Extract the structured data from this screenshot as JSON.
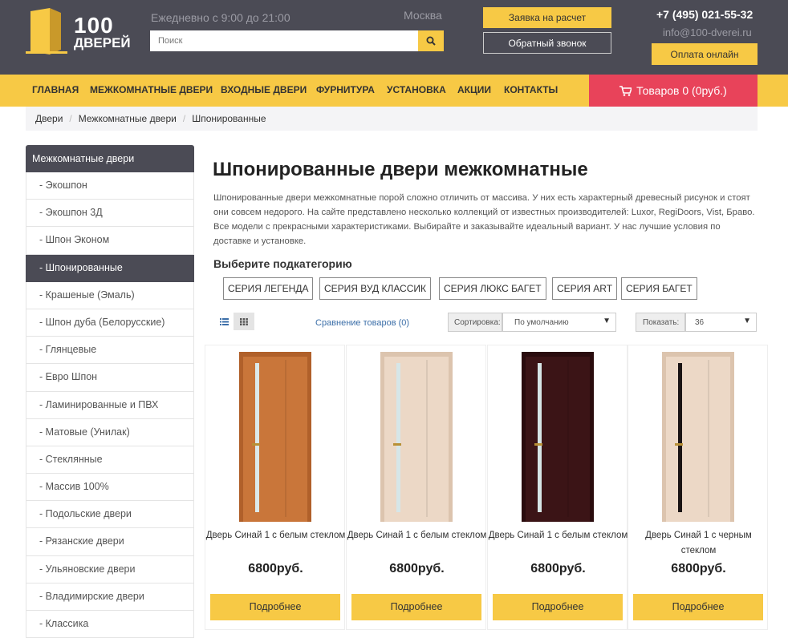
{
  "header": {
    "logo_num": "100",
    "logo_word": "ДВЕРЕЙ",
    "hours": "Ежедневно с 9:00 до 21:00",
    "city": "Москва",
    "search_placeholder": "Поиск",
    "request_btn": "Заявка на расчет",
    "callback_btn": "Обратный звонок",
    "phone": "+7 (495) 021-55-32",
    "email": "info@100-dverei.ru",
    "pay_btn": "Оплата онлайн"
  },
  "nav": {
    "items": [
      "ГЛАВНАЯ",
      "МЕЖКОМНАТНЫЕ ДВЕРИ",
      "ВХОДНЫЕ ДВЕРИ",
      "ФУРНИТУРА",
      "УСТАНОВКА",
      "АКЦИИ",
      "КОНТАКТЫ"
    ],
    "cart": "Товаров 0 (0руб.)"
  },
  "breadcrumb": [
    "Двери",
    "Межкомнатные двери",
    "Шпонированные"
  ],
  "sidebar": {
    "title": "Межкомнатные двери",
    "items": [
      "- Экошпон",
      "- Экошпон 3Д",
      "- Шпон Эконом",
      "- Шпонированные",
      "- Крашеные (Эмаль)",
      "- Шпон дуба (Белорусские)",
      "- Глянцевые",
      "- Евро Шпон",
      "- Ламинированные и ПВХ",
      "- Матовые (Унилак)",
      "- Стеклянные",
      "- Массив 100%",
      "- Подольские двери",
      "- Рязанские двери",
      "- Ульяновские двери",
      "- Владимирские двери",
      "- Классика"
    ],
    "active_index": 3
  },
  "main": {
    "title": "Шпонированные двери межкомнатные",
    "description": "Шпонированные двери межкомнатные порой сложно отличить от массива. У них есть характерный древесный рисунок и стоят они совсем недорого. На сайте представлено несколько коллекций от известных производителей: Luxor, RegiDoors, Vist, Браво. Все модели с прекрасными характеристиками. Выбирайте и заказывайте идеальный вариант. У нас лучшие условия по доставке и установке.",
    "subcat_title": "Выберите подкатегорию",
    "subcats": [
      "СЕРИЯ ЛЕГЕНДА",
      "СЕРИЯ ВУД КЛАССИК",
      "СЕРИЯ ЛЮКС БАГЕТ",
      "СЕРИЯ ART",
      "СЕРИЯ БАГЕТ"
    ],
    "compare": "Сравнение товаров (0)",
    "sort_label": "Сортировка:",
    "sort_value": "По умолчанию",
    "show_label": "Показать:",
    "show_value": "36"
  },
  "products": [
    {
      "name": "Дверь Синай 1 с белым стеклом",
      "price": "6800руб.",
      "btn": "Подробнее",
      "color": "#c9763a",
      "glass": "#dce9ea"
    },
    {
      "name": "Дверь Синай 1 с белым стеклом",
      "price": "6800руб.",
      "btn": "Подробнее",
      "color": "#ecd8c6",
      "glass": "#d6e6e8"
    },
    {
      "name": "Дверь Синай 1 с белым стеклом",
      "price": "6800руб.",
      "btn": "Подробнее",
      "color": "#3b1416",
      "glass": "#d7e6e6"
    },
    {
      "name": "Дверь Синай 1 с черным стеклом",
      "price": "6800руб.",
      "btn": "Подробнее",
      "color": "#ecd8c6",
      "glass": "#1a1414"
    }
  ]
}
